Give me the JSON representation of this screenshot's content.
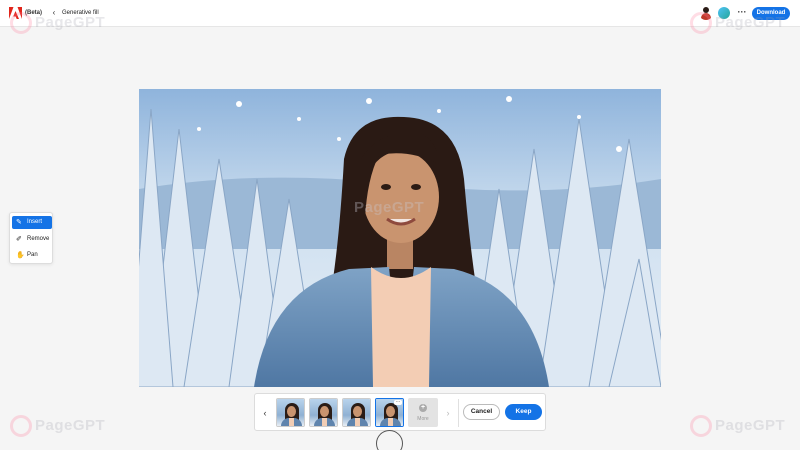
{
  "header": {
    "app_tag": "(Beta)",
    "back_symbol": "‹",
    "page_title": "Generative fill",
    "more_symbol": "···",
    "download_label": "Download"
  },
  "watermark": {
    "text": "PageGPT"
  },
  "tools": {
    "items": [
      {
        "label": "Insert",
        "icon": "insert-brush-icon",
        "active": true
      },
      {
        "label": "Remove",
        "icon": "remove-brush-icon",
        "active": false
      },
      {
        "label": "Pan",
        "icon": "hand-icon",
        "active": false
      }
    ]
  },
  "variations": {
    "prev_symbol": "‹",
    "next_symbol": "›",
    "thumbnails": 4,
    "selected_index": 4,
    "more_label": "More",
    "more_symbol": "+"
  },
  "actions": {
    "cancel_label": "Cancel",
    "keep_label": "Keep"
  },
  "colors": {
    "accent": "#1473e6"
  }
}
